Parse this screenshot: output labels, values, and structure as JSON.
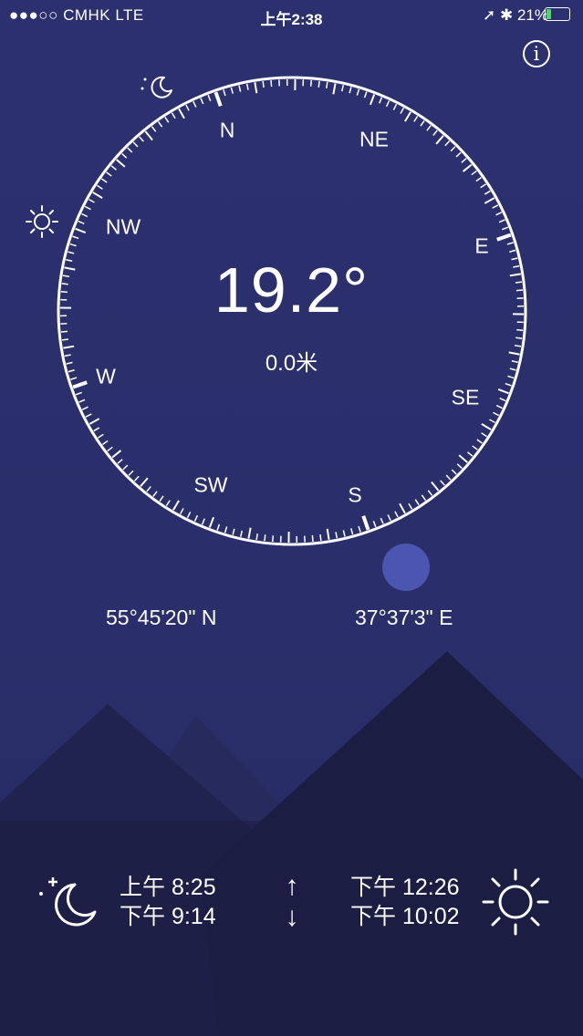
{
  "status_bar": {
    "carrier": "●●●○○ CMHK   LTE",
    "time": "上午2:38",
    "battery": "21%",
    "battery_level": 0.21
  },
  "compass": {
    "heading": "19.2°",
    "altitude": "0.0米",
    "directions": {
      "n": "N",
      "ne": "NE",
      "e": "E",
      "se": "SE",
      "s": "S",
      "sw": "SW",
      "w": "W",
      "nw": "NW"
    }
  },
  "location": {
    "latitude": "55°45'20\" N",
    "longitude": "37°37'3\" E"
  },
  "moon": {
    "rise": "上午 8:25",
    "set": "下午 9:14"
  },
  "sun": {
    "rise": "下午 12:26",
    "set": "下午 10:02"
  },
  "arrows": {
    "up": "↑",
    "down": "↓"
  },
  "colors": {
    "background": "#2b2f6b",
    "mountain_dark": "#1d1f45",
    "mountain_mid": "#25285a",
    "moon_dot": "#4a56b0"
  }
}
